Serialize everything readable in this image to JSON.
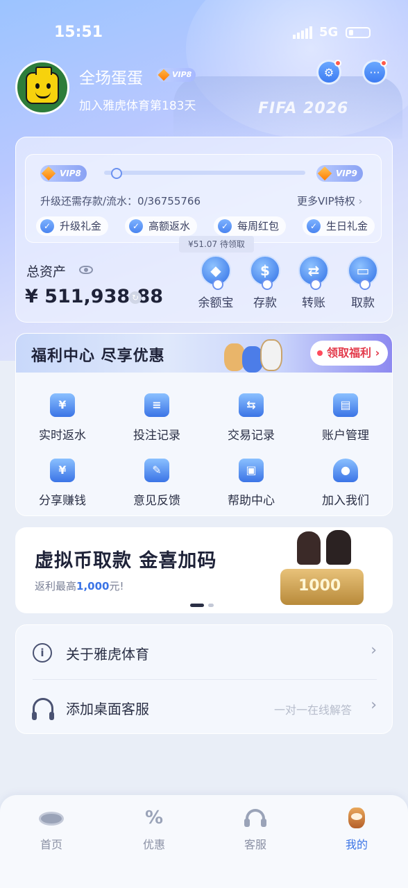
{
  "status_bar": {
    "time": "15:51",
    "network": "5G"
  },
  "profile": {
    "username": "全场蛋蛋",
    "vip_badge": "VIP8",
    "join_text": "加入雅虎体育第183天"
  },
  "header_backdrop_text": "FIFA 2026",
  "vip": {
    "current_level": "VIP8",
    "next_level": "VIP9",
    "progress": 0.0,
    "upgrade_text": "升级还需存款/流水：0/36755766",
    "more_link": "更多VIP特权",
    "perks": [
      "升级礼金",
      "高额返水",
      "每周红包",
      "生日礼金"
    ],
    "pending_text": "¥51.07 待领取"
  },
  "assets": {
    "label": "总资产",
    "value": "¥ 511,938.88",
    "actions": [
      "余额宝",
      "存款",
      "转账",
      "取款"
    ]
  },
  "welfare": {
    "title": "福利中心  尽享优惠",
    "claim_button": "领取福利",
    "items": [
      "实时返水",
      "投注记录",
      "交易记录",
      "账户管理",
      "分享赚钱",
      "意见反馈",
      "帮助中心",
      "加入我们"
    ]
  },
  "promo": {
    "title": "虚拟币取款 金喜加码",
    "subtitle_prefix": "返利最高",
    "subtitle_amount": "1,000",
    "subtitle_suffix": "元!",
    "art_text": "1000"
  },
  "menu": [
    {
      "label": "关于雅虎体育",
      "hint": ""
    },
    {
      "label": "添加桌面客服",
      "hint": "一对一在线解答"
    }
  ],
  "tabs": [
    {
      "label": "首页",
      "active": false
    },
    {
      "label": "优惠",
      "active": false
    },
    {
      "label": "客服",
      "active": false
    },
    {
      "label": "我的",
      "active": true
    }
  ],
  "colors": {
    "accent": "#3b74e6",
    "claim_red": "#e33a4b",
    "notify_dot": "#ff5a4a"
  }
}
